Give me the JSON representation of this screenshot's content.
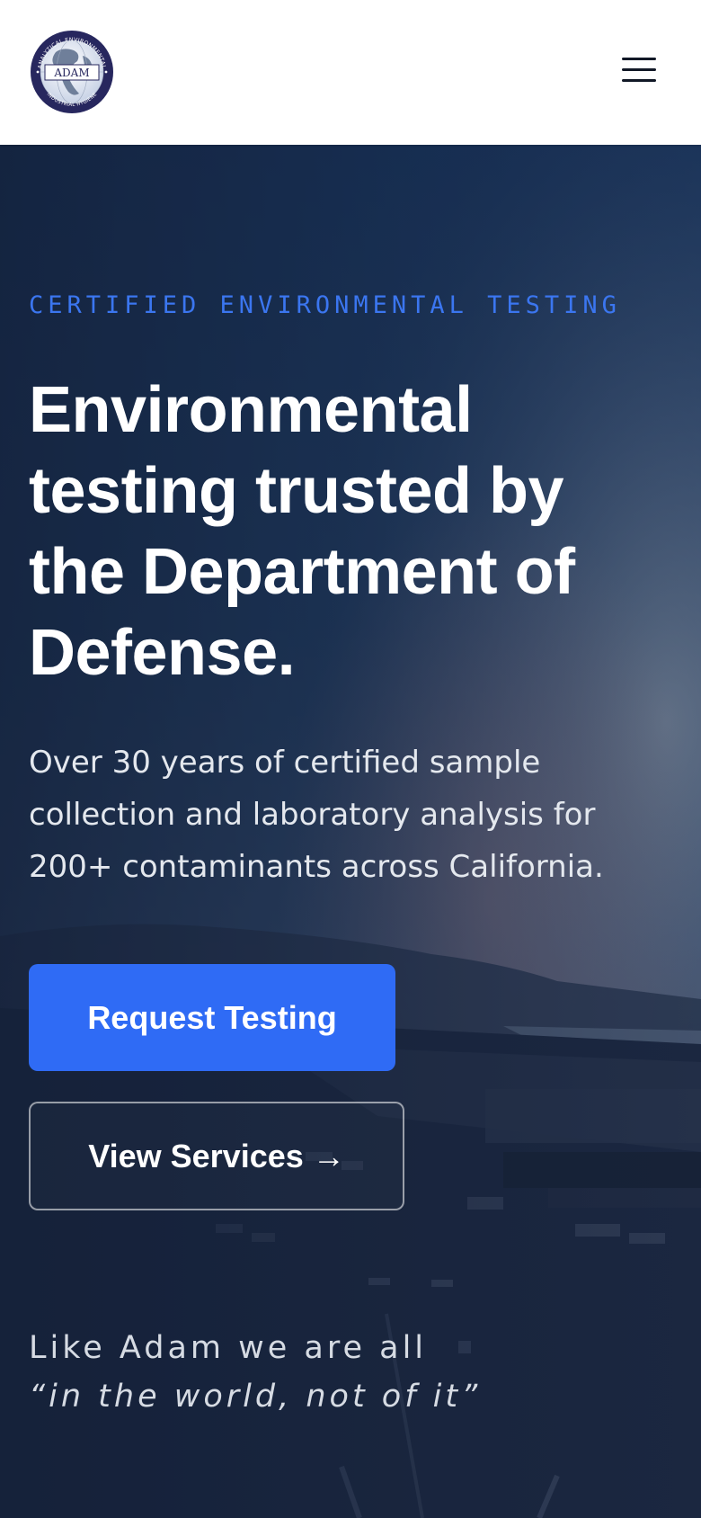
{
  "header": {
    "logo": {
      "ring_text_top": "ANALYTICAL ENVIRONMENTAL",
      "center_text": "ADAM",
      "ring_text_bottom": "INDUSTRIAL HYGIENE"
    },
    "menu_icon": "hamburger-menu-icon"
  },
  "hero": {
    "eyebrow": "CERTIFIED ENVIRONMENTAL TESTING",
    "headline": "Environmental testing trusted by the Department of Defense.",
    "subtext": "Over 30 years of certified sample collection and laboratory analysis for 200+ contaminants across California.",
    "primary_button": "Request Testing",
    "secondary_button": "View Services →",
    "motto_line1": "Like Adam we are all",
    "motto_line2": "“in the world, not of it”"
  },
  "colors": {
    "accent": "#2f6bf5",
    "eyebrow": "#3b76f0",
    "logo_navy": "#27275e",
    "hero_overlay": "#1c2c48"
  }
}
